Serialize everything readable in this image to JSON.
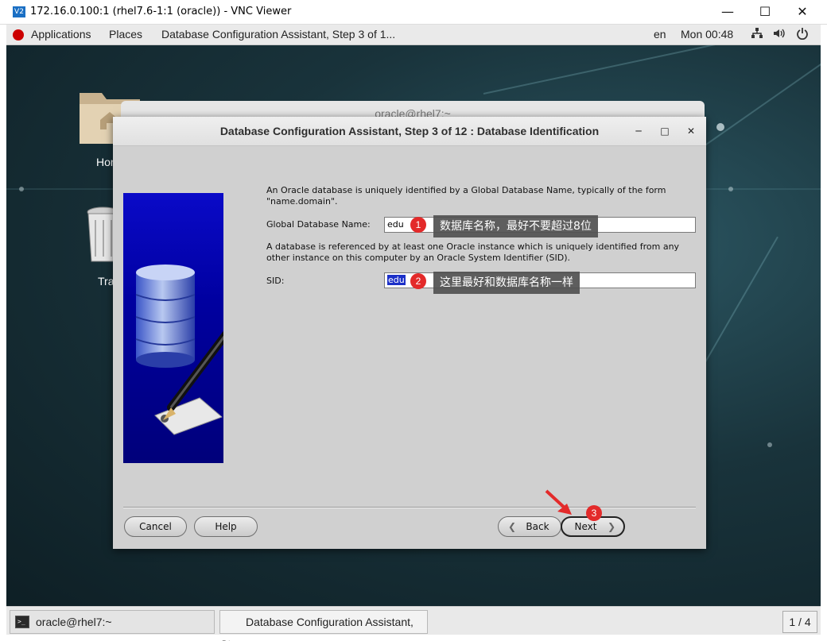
{
  "vnc": {
    "title": "172.16.0.100:1 (rhel7.6-1:1 (oracle)) - VNC Viewer",
    "logo_text": "V2"
  },
  "gnome": {
    "applications": "Applications",
    "places": "Places",
    "active_app": "Database Configuration Assistant, Step 3 of 1...",
    "lang": "en",
    "clock": "Mon 00:48"
  },
  "desktop": {
    "icons": [
      {
        "label": "Hor"
      },
      {
        "label": "Tra"
      }
    ]
  },
  "back_window": {
    "title": "oracle@rhel7:~"
  },
  "dialog": {
    "title": "Database Configuration Assistant, Step 3 of 12 : Database Identification",
    "intro_text": "An Oracle database is uniquely identified by a Global Database Name, typically of the form \"name.domain\".",
    "global_db_label": "Global Database Name:",
    "global_db_value": "edu",
    "sid_description": "A database is referenced by at least one Oracle instance which is uniquely identified from any other instance on this computer by an Oracle System Identifier (SID).",
    "sid_label": "SID:",
    "sid_value": "edu",
    "buttons": {
      "cancel": "Cancel",
      "help": "Help",
      "back": "Back",
      "next": "Next"
    }
  },
  "annotations": [
    {
      "number": "1",
      "text": "数据库名称，最好不要超过8位"
    },
    {
      "number": "2",
      "text": "这里最好和数据库名称一样"
    },
    {
      "number": "3"
    }
  ],
  "taskbar": {
    "items": [
      {
        "label": "oracle@rhel7:~"
      },
      {
        "label": "Database Configuration Assistant, St..."
      }
    ],
    "pager": "1 / 4"
  },
  "colors": {
    "annotation_badge": "#e32a2a",
    "callout_bg": "#505050",
    "selection": "#1c30c8"
  }
}
